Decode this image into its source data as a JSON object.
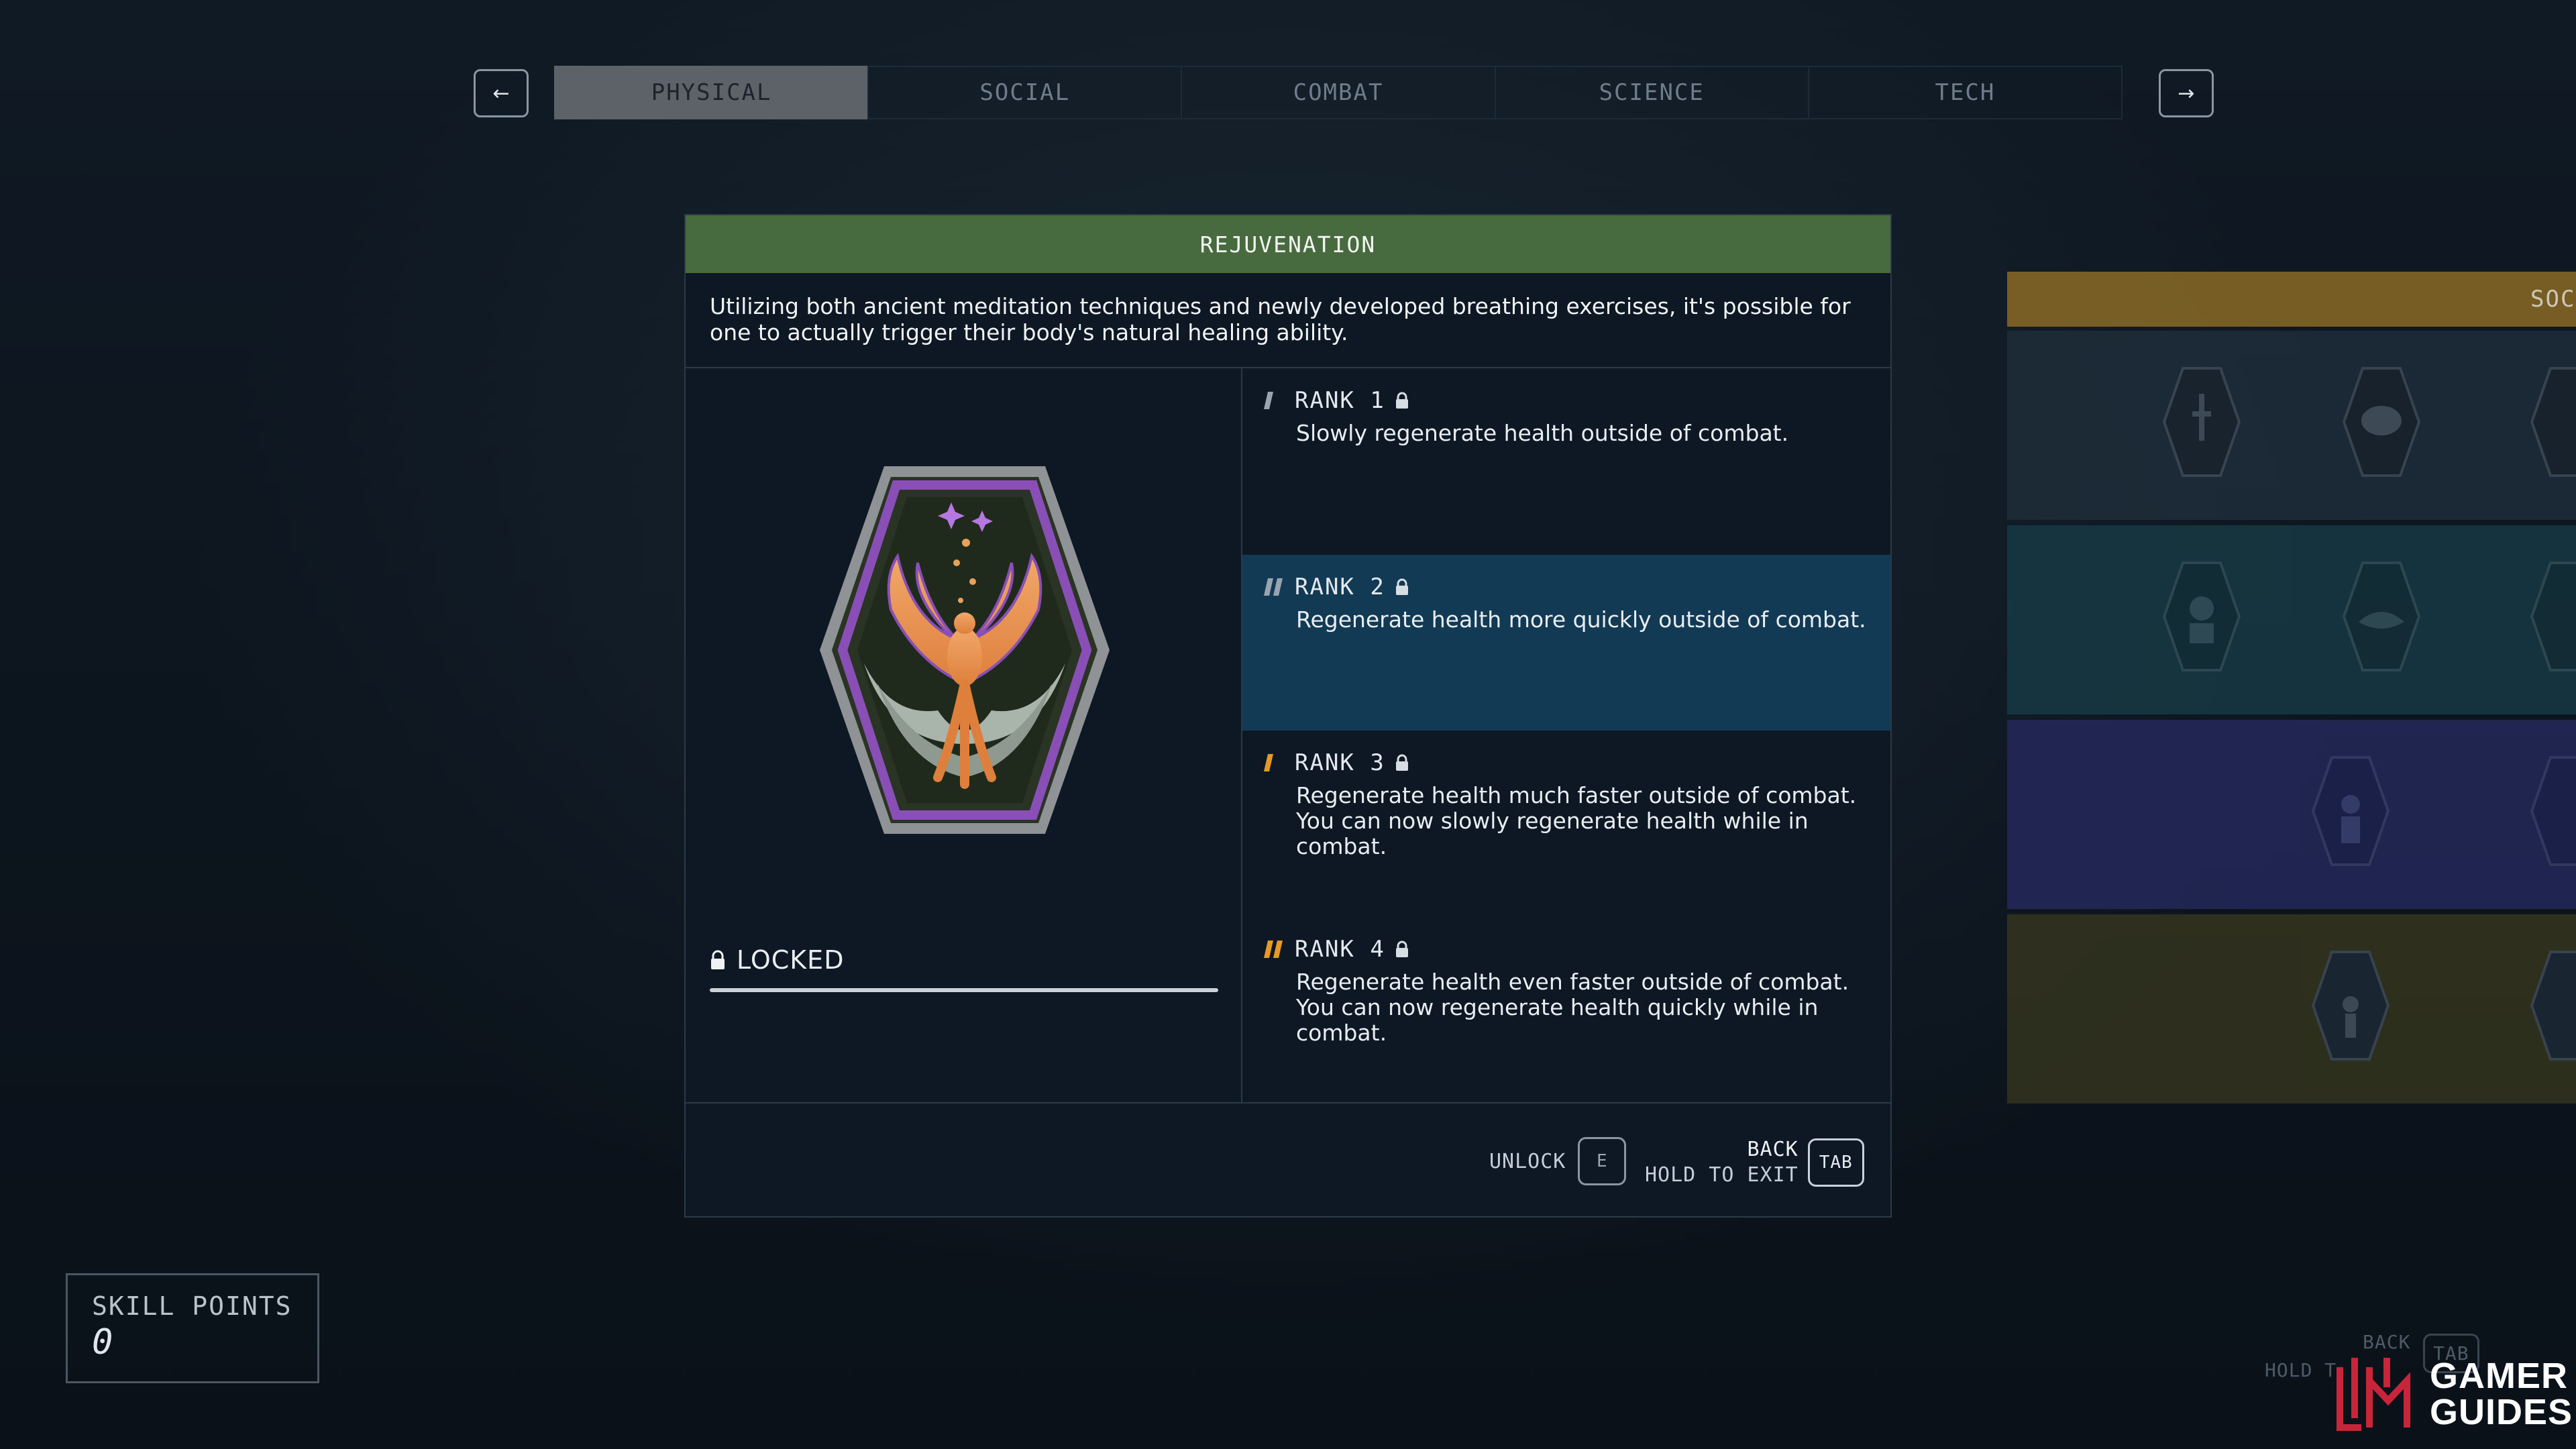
{
  "nav": {
    "prev_arrow": "←",
    "next_arrow": "→",
    "tabs": [
      {
        "label": "PHYSICAL",
        "active": true
      },
      {
        "label": "SOCIAL",
        "active": false
      },
      {
        "label": "COMBAT",
        "active": false
      },
      {
        "label": "SCIENCE",
        "active": false
      },
      {
        "label": "TECH",
        "active": false
      }
    ]
  },
  "skill": {
    "title": "REJUVENATION",
    "description": "Utilizing both ancient meditation techniques and newly developed breathing exercises, it's possible for one to actually trigger their body's natural healing ability.",
    "status": "LOCKED",
    "header_color": "#476a3f",
    "badge_icon": "phoenix-badge-icon",
    "ranks": [
      {
        "title": "RANK 1",
        "text": "Slowly regenerate health outside of combat.",
        "pip_color": "#9aa4ae"
      },
      {
        "title": "RANK 2",
        "text": "Regenerate health more quickly outside of combat.",
        "pip_color": "#9aa4ae"
      },
      {
        "title": "RANK 3",
        "text": "Regenerate health much faster outside of combat. You can now slowly regenerate health while in combat.",
        "pip_color": "#e39b26"
      },
      {
        "title": "RANK 4",
        "text": "Regenerate health even faster outside of combat. You can now regenerate health quickly while in combat.",
        "pip_color": "#e39b26"
      }
    ]
  },
  "footer": {
    "unlock_label": "UNLOCK",
    "unlock_key": "E",
    "back_label": "BACK",
    "hold_label": "HOLD TO EXIT",
    "back_key": "TAB"
  },
  "side_panel": {
    "header": "SOCI",
    "header_color": "#8a6a25",
    "row_colors": [
      "#1e2d3a",
      "#173944",
      "#24285a",
      "#34341e"
    ]
  },
  "skill_points": {
    "label": "SKILL POINTS",
    "value": "0"
  },
  "background_hint": {
    "back": "BACK",
    "hold": "HOLD T",
    "key": "TAB"
  },
  "watermark": {
    "line1": "GAMER",
    "line2": "GUIDES",
    "accent": "#c8253a"
  }
}
